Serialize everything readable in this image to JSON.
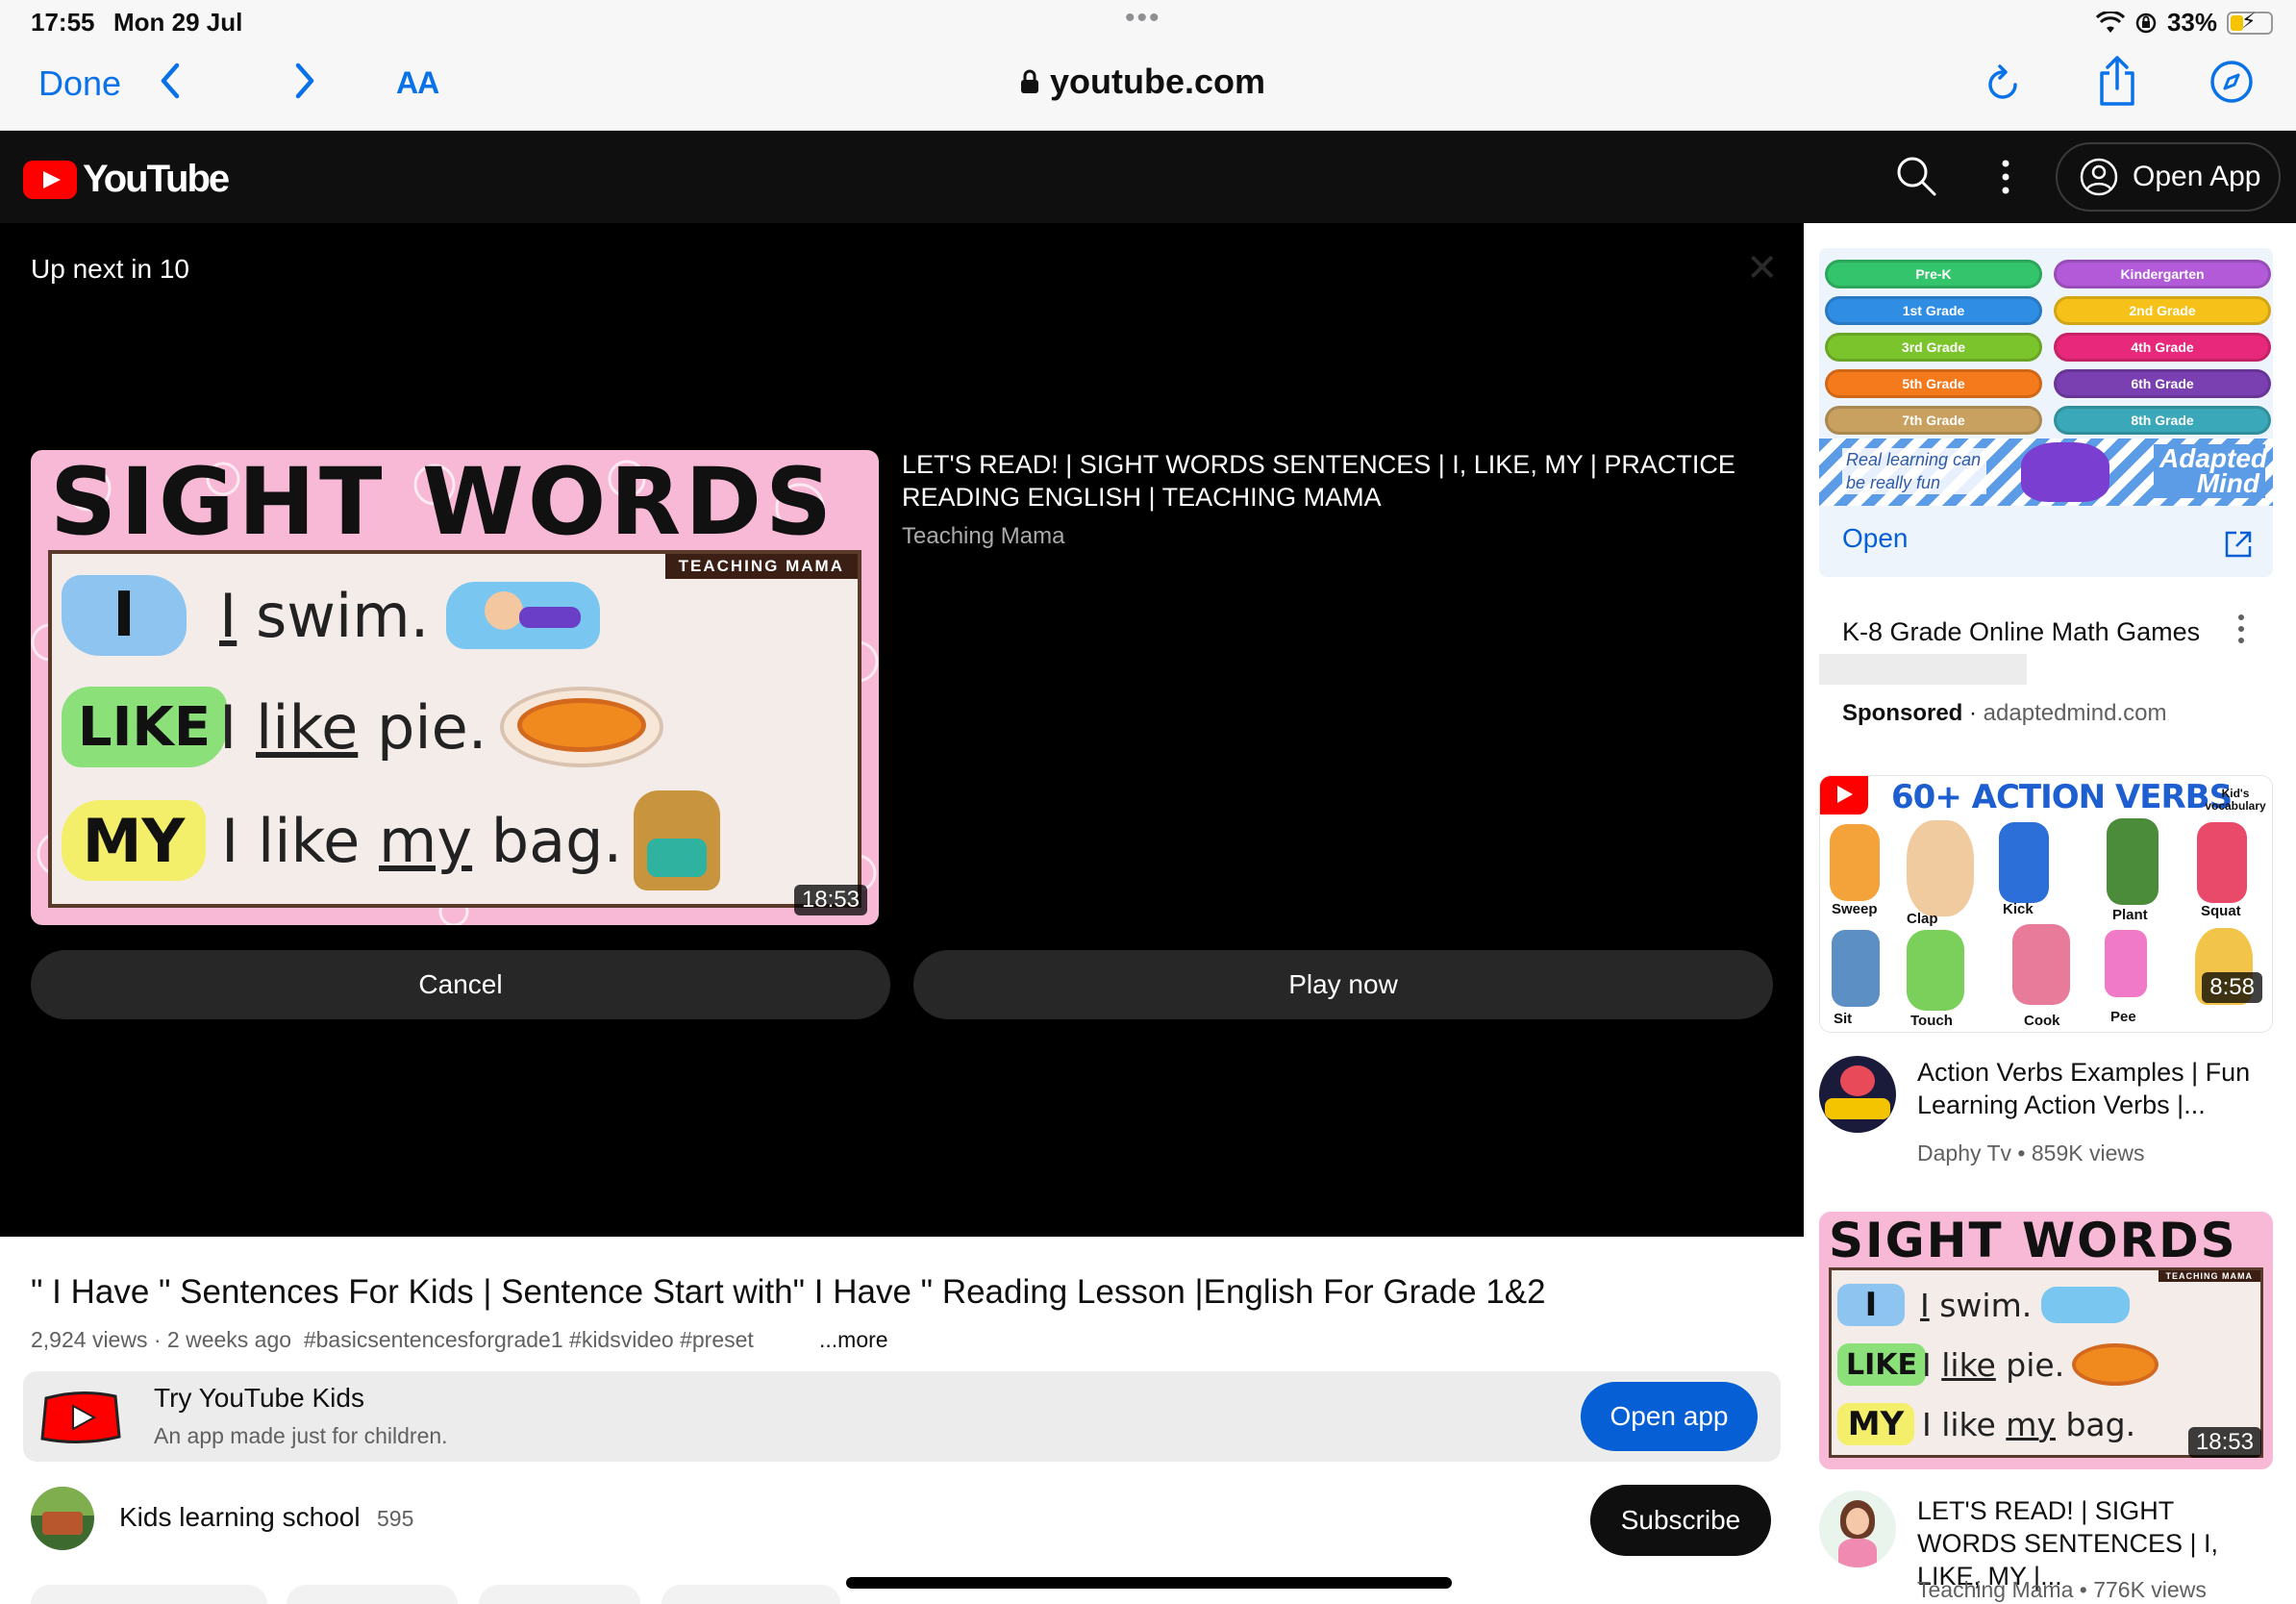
{
  "status_bar": {
    "time": "17:55",
    "date": "Mon 29 Jul",
    "battery": "33%"
  },
  "browser": {
    "done_label": "Done",
    "text_size_label": "AA",
    "url": "youtube.com"
  },
  "youtube_header": {
    "logo_text": "YouTube",
    "open_app_label": "Open App"
  },
  "up_next": {
    "countdown_text": "Up next in 10",
    "video_title": "LET'S READ! | SIGHT WORDS SENTENCES | I, LIKE, MY | PRACTICE READING ENGLISH | TEACHING MAMA",
    "channel": "Teaching Mama",
    "duration": "18:53",
    "cancel_label": "Cancel",
    "play_now_label": "Play now",
    "thumbnail": {
      "heading": "SIGHT WORDS",
      "brand": "TEACHING MAMA",
      "rows": [
        {
          "word": "I",
          "sentence_parts": [
            "I",
            " swim."
          ],
          "color": "#8ec5f0"
        },
        {
          "word": "LIKE",
          "sentence_parts": [
            "I ",
            "like",
            " pie."
          ],
          "color": "#8be07a"
        },
        {
          "word": "MY",
          "sentence_parts": [
            "I like ",
            "my",
            " bag."
          ],
          "color": "#f4ef6a"
        }
      ]
    }
  },
  "video": {
    "title": "\" I Have \" Sentences For Kids | Sentence Start with\" I Have \" Reading Lesson |English For Grade 1&2",
    "views": "2,924 views",
    "age": "2 weeks ago",
    "tags": "#basicsentencesforgrade1 #kidsvideo #preset",
    "more_label": "...more"
  },
  "kids_banner": {
    "title": "Try YouTube Kids",
    "subtitle": "An app made just for children.",
    "open_label": "Open app"
  },
  "channel": {
    "name": "Kids learning school",
    "subscribers": "595",
    "subscribe_label": "Subscribe"
  },
  "sidebar": {
    "ad": {
      "grades": [
        {
          "label": "Pre-K",
          "color": "#34c46c"
        },
        {
          "label": "Kindergarten",
          "color": "#b35ad8"
        },
        {
          "label": "1st Grade",
          "color": "#2f8de4"
        },
        {
          "label": "2nd Grade",
          "color": "#f6c21a"
        },
        {
          "label": "3rd Grade",
          "color": "#7cc42c"
        },
        {
          "label": "4th Grade",
          "color": "#e8287a"
        },
        {
          "label": "5th Grade",
          "color": "#f47a1c"
        },
        {
          "label": "6th Grade",
          "color": "#7a3fb0"
        },
        {
          "label": "7th Grade",
          "color": "#c8a060"
        },
        {
          "label": "8th Grade",
          "color": "#3aa8b8"
        }
      ],
      "tagline": "Real learning can be really fun",
      "brand": "Adapted Mind",
      "open_label": "Open",
      "title": "K-8 Grade Online Math Games",
      "sponsored_label": "Sponsored",
      "domain": "adaptedmind.com"
    },
    "recommendations": [
      {
        "title": "Action Verbs Examples | Fun Learning Action Verbs |...",
        "channel": "Daphy Tv",
        "views": "859K views",
        "duration": "8:58",
        "thumb_heading": "60+ ACTION VERBS",
        "thumb_badge": "Kid's vocabulary",
        "thumb_labels": [
          "Sweep",
          "Clap",
          "Kick",
          "Plant",
          "Squat",
          "Sit",
          "Touch",
          "Cook",
          "Pee"
        ]
      },
      {
        "title": "LET'S READ! | SIGHT WORDS SENTENCES | I, LIKE, MY |...",
        "channel": "Teaching Mama",
        "views": "776K views",
        "duration": "18:53"
      }
    ]
  }
}
